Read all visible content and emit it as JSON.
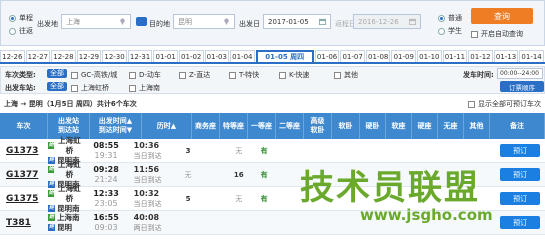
{
  "search": {
    "trip_types": [
      "单程",
      "往返"
    ],
    "from_label": "出发地",
    "from_value": "上海",
    "to_label": "目的地",
    "to_value": "昆明",
    "depart_label": "出发日",
    "depart_value": "2017-01-05",
    "return_label": "返程日",
    "return_value": "2016-12-26",
    "passenger_types": [
      "普通",
      "学生"
    ],
    "query_label": "查询",
    "auto_query_label": "开启自动查询"
  },
  "dates": [
    "12-26",
    "12-27",
    "12-28",
    "12-29",
    "12-30",
    "12-31",
    "01-01",
    "01-02",
    "01-03",
    "01-04",
    "01-05 周四",
    "01-06",
    "01-07",
    "01-08",
    "01-09",
    "01-10",
    "01-11",
    "01-12",
    "01-13",
    "01-14"
  ],
  "filters": {
    "type_label": "车次类型:",
    "all_label": "全部",
    "types": [
      "GC-高铁/城",
      "D-动车",
      "Z-直达",
      "T-特快",
      "K-快速",
      "其他"
    ],
    "station_label": "出发车站:",
    "stations": [
      "上海虹桥",
      "上海南"
    ],
    "time_label": "发车时间:",
    "time_value": "00:00--24:00",
    "sort_label": "订票顺序"
  },
  "summary": {
    "route": "上海 → 昆明（1月5日 周四）共计6个车次",
    "show_all": "显示全部可预订车次"
  },
  "table": {
    "headers": [
      "车次",
      "出发站\n到达站",
      "出发时间▲\n到达时间▼",
      "历时▲",
      "商务座",
      "特等座",
      "一等座",
      "二等座",
      "高级\n软卧",
      "软卧",
      "硬卧",
      "软座",
      "硬座",
      "无座",
      "其他",
      "备注"
    ],
    "rows": [
      {
        "no": "G1373",
        "from": "上海虹桥",
        "to": "昆明南",
        "dep": "08:55",
        "arr": "19:31",
        "dur": "10:36",
        "day": "当日到达",
        "seats": [
          "3",
          "",
          "无",
          "有",
          "",
          "",
          "",
          "",
          "",
          "",
          "",
          ""
        ],
        "book": "预订"
      },
      {
        "no": "G1377",
        "from": "上海虹桥",
        "to": "昆明南",
        "dep": "09:28",
        "arr": "21:24",
        "dur": "11:56",
        "day": "当日到达",
        "seats": [
          "无",
          "",
          "16",
          "有",
          "",
          "",
          "",
          "",
          "",
          "",
          "",
          ""
        ],
        "book": "预订"
      },
      {
        "no": "G1375",
        "from": "上海虹桥",
        "to": "昆明南",
        "dep": "12:33",
        "arr": "23:05",
        "dur": "10:32",
        "day": "当日到达",
        "seats": [
          "5",
          "",
          "无",
          "有",
          "",
          "",
          "",
          "",
          "",
          "",
          "",
          ""
        ],
        "book": "预订"
      },
      {
        "no": "T381",
        "from": "上海南",
        "to": "昆明",
        "dep": "16:55",
        "arr": "09:03",
        "dur": "40:08",
        "day": "两日到达",
        "seats": [
          "",
          "",
          "",
          "",
          "",
          "",
          "",
          "",
          "",
          "",
          "",
          ""
        ],
        "book": "预订"
      }
    ]
  },
  "watermark": {
    "main": "技术员联盟",
    "url": "www.jsgho.com"
  }
}
